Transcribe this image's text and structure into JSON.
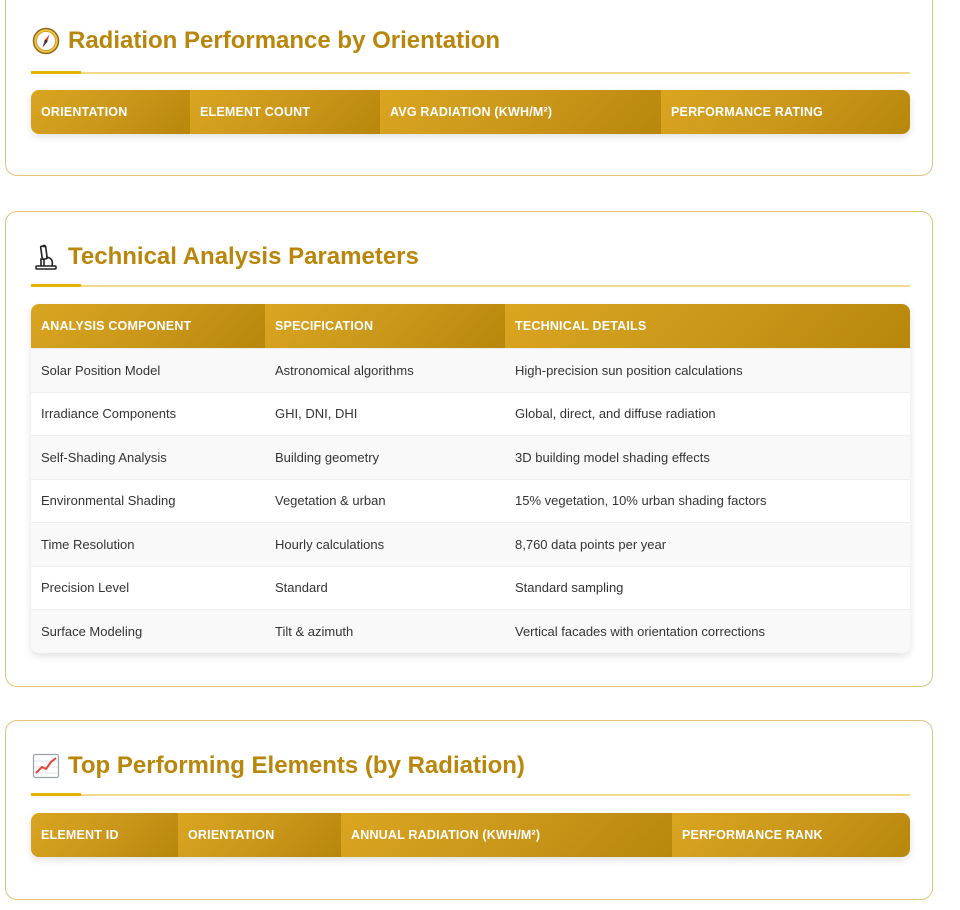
{
  "radiation_section": {
    "title": "Radiation Performance by Orientation",
    "icon": "compass-icon",
    "columns": [
      "Orientation",
      "Element Count",
      "Avg Radiation (kWh/m²)",
      "Performance Rating"
    ]
  },
  "technical_section": {
    "title": "Technical Analysis Parameters",
    "icon": "microscope-icon",
    "columns": [
      "Analysis Component",
      "Specification",
      "Technical Details"
    ],
    "rows": [
      [
        "Solar Position Model",
        "Astronomical algorithms",
        "High-precision sun position calculations"
      ],
      [
        "Irradiance Components",
        "GHI, DNI, DHI",
        "Global, direct, and diffuse radiation"
      ],
      [
        "Self-Shading Analysis",
        "Building geometry",
        "3D building model shading effects"
      ],
      [
        "Environmental Shading",
        "Vegetation & urban",
        "15% vegetation, 10% urban shading factors"
      ],
      [
        "Time Resolution",
        "Hourly calculations",
        "8,760 data points per year"
      ],
      [
        "Precision Level",
        "Standard",
        "Standard sampling"
      ],
      [
        "Surface Modeling",
        "Tilt & azimuth",
        "Vertical facades with orientation corrections"
      ]
    ]
  },
  "top_section": {
    "title": "Top Performing Elements (by Radiation)",
    "icon": "chart-increasing-icon",
    "columns": [
      "Element ID",
      "Orientation",
      "Annual Radiation (kWh/m²)",
      "Performance Rank"
    ]
  },
  "colors": {
    "accent": "#b8860b",
    "header_gradient_start": "#daa520",
    "header_gradient_end": "#b8860b",
    "card_border": "#e2c47a"
  }
}
